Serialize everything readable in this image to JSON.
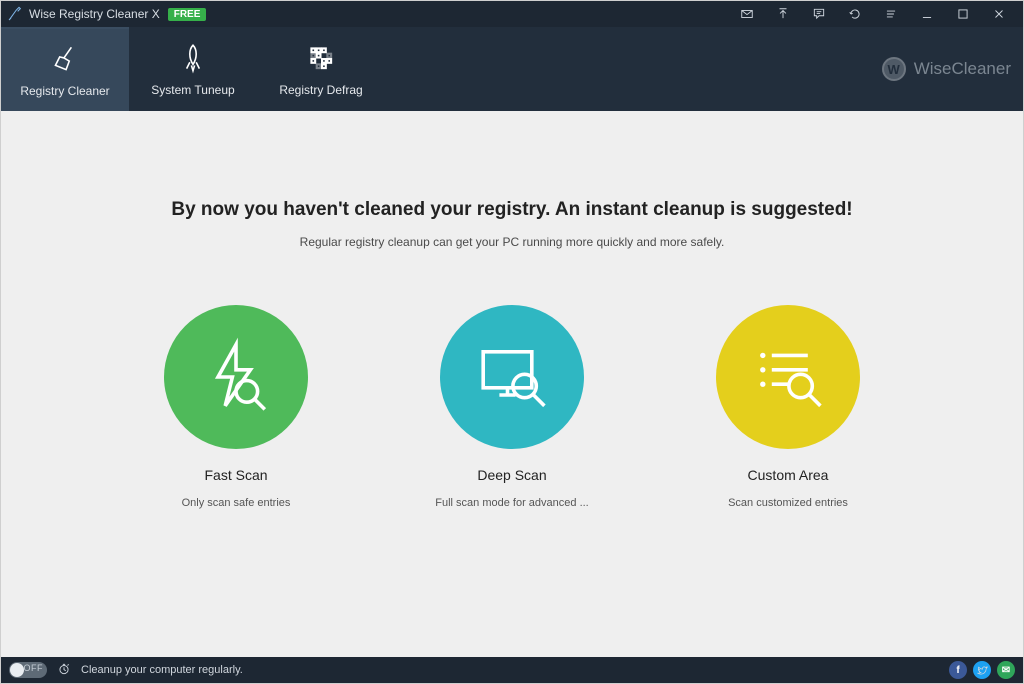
{
  "title": "Wise Registry Cleaner X",
  "badge": "FREE",
  "brand": "WiseCleaner",
  "brand_initial": "W",
  "tabs": {
    "cleaner": "Registry Cleaner",
    "tuneup": "System Tuneup",
    "defrag": "Registry Defrag"
  },
  "headline": "By now you haven't cleaned your registry. An instant cleanup is suggested!",
  "subhead": "Regular registry cleanup can get your PC running more quickly and more safely.",
  "options": {
    "fast": {
      "title": "Fast Scan",
      "desc": "Only scan safe entries"
    },
    "deep": {
      "title": "Deep Scan",
      "desc": "Full scan mode for advanced ..."
    },
    "custom": {
      "title": "Custom Area",
      "desc": "Scan customized entries"
    }
  },
  "status": {
    "toggle": "OFF",
    "message": "Cleanup your computer regularly."
  },
  "social": {
    "fb": "f",
    "tw": "t",
    "ml": "✉"
  }
}
